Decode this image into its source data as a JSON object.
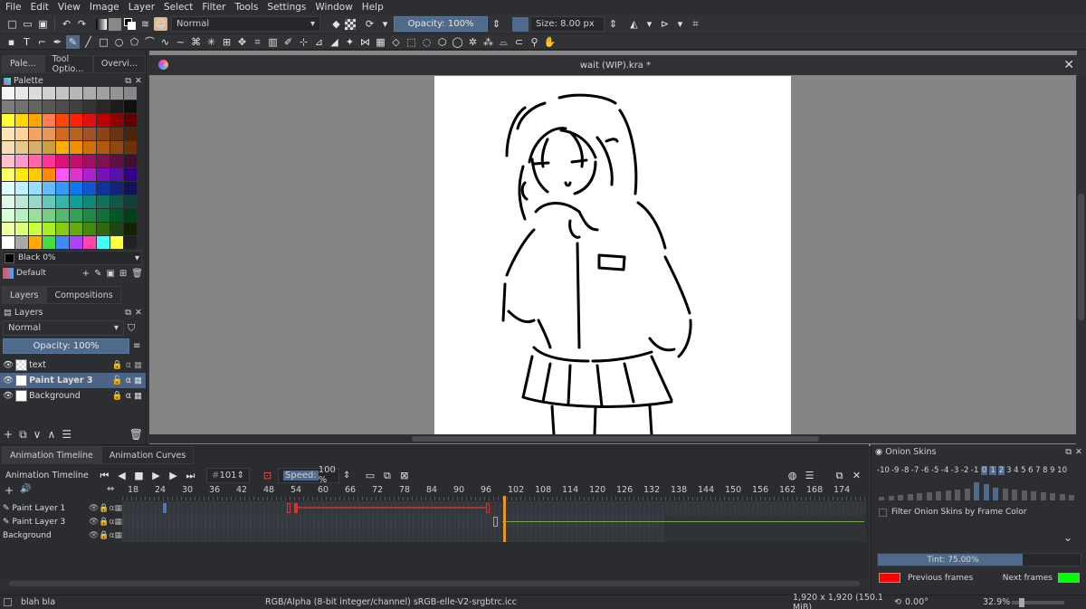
{
  "menubar": [
    "File",
    "Edit",
    "View",
    "Image",
    "Layer",
    "Select",
    "Filter",
    "Tools",
    "Settings",
    "Window",
    "Help"
  ],
  "toolbar": {
    "blend_mode": "Normal",
    "opacity": "Opacity: 100%",
    "size": "Size: 8.00 px"
  },
  "left_tabs": [
    "Pale...",
    "Tool Optio...",
    "Overvi..."
  ],
  "palette": {
    "title": "Palette",
    "current_color": "Black 0%",
    "palette_name": "Default",
    "rows": [
      [
        "#f5f5f5",
        "#e8e8e8",
        "#dcdcdc",
        "#d0d0d0",
        "#c4c4c4",
        "#b8b8b8",
        "#acacac",
        "#a0a0a0",
        "#949494",
        "#888888"
      ],
      [
        "#7c7c7c",
        "#707070",
        "#646464",
        "#585858",
        "#4c4c4c",
        "#404040",
        "#343434",
        "#282828",
        "#1c1c1c",
        "#101010"
      ],
      [
        "#ffff33",
        "#ffd700",
        "#ffa500",
        "#ff7f50",
        "#ff4500",
        "#ff2200",
        "#e01010",
        "#c00000",
        "#900000",
        "#600000"
      ],
      [
        "#ffe4b5",
        "#ffd39b",
        "#f4a460",
        "#e8965c",
        "#d2691e",
        "#b5651d",
        "#a0522d",
        "#8b4513",
        "#6b3410",
        "#4a2408"
      ],
      [
        "#f5deb3",
        "#e6c88a",
        "#d4b06a",
        "#c8a040",
        "#ffb000",
        "#f09000",
        "#d07000",
        "#b05a10",
        "#904810",
        "#703008"
      ],
      [
        "#ffc0cb",
        "#ff99cc",
        "#ff66aa",
        "#ff3399",
        "#e0107a",
        "#c0106a",
        "#a01060",
        "#801050",
        "#601040",
        "#401030"
      ],
      [
        "#ffff66",
        "#ffee00",
        "#ffcc00",
        "#ff8800",
        "#ff55ff",
        "#dd33cc",
        "#aa22cc",
        "#7711bb",
        "#5511aa",
        "#330088"
      ],
      [
        "#e0ffff",
        "#c0f0ff",
        "#99ddff",
        "#66bbff",
        "#3399ff",
        "#1177ee",
        "#1155cc",
        "#113399",
        "#112277",
        "#111155"
      ],
      [
        "#e0f8e8",
        "#c0e8d8",
        "#99d8c8",
        "#66c8b8",
        "#33b8a8",
        "#11a098",
        "#118878",
        "#117058",
        "#115848",
        "#114038"
      ],
      [
        "#d8ffd8",
        "#b8f0c0",
        "#99e0a0",
        "#77cc88",
        "#55b870",
        "#33a058",
        "#228848",
        "#117038",
        "#005828",
        "#004018"
      ],
      [
        "#eeffaa",
        "#ddff77",
        "#ccff44",
        "#aaee22",
        "#88cc11",
        "#66aa11",
        "#448811",
        "#336611",
        "#224411",
        "#112200"
      ],
      [
        "#ffffff",
        "#aaaaaa",
        "#ffaa00",
        "#44dd44",
        "#4488ff",
        "#aa44ff",
        "#ff44aa",
        "#44ffff",
        "#ffff44",
        "#222222"
      ]
    ]
  },
  "layers_tabs": [
    "Layers",
    "Compositions"
  ],
  "layers": {
    "title": "Layers",
    "blend_mode": "Normal",
    "opacity": "Opacity:  100%",
    "items": [
      {
        "name": "text",
        "selected": false
      },
      {
        "name": "Paint Layer 3",
        "selected": true
      },
      {
        "name": "Background",
        "selected": false
      }
    ]
  },
  "document": {
    "title": "wait (WIP).kra *"
  },
  "timeline": {
    "tabs": [
      "Animation Timeline",
      "Animation Curves"
    ],
    "title": "Animation Timeline",
    "frame": "101",
    "speed_label": "Speed:",
    "speed_value": "100 %",
    "ruler": [
      "18",
      "24",
      "30",
      "36",
      "42",
      "48",
      "54",
      "60",
      "66",
      "72",
      "78",
      "84",
      "90",
      "96",
      "102",
      "108",
      "114",
      "120",
      "126",
      "132",
      "138",
      "144",
      "150",
      "156",
      "162",
      "168",
      "174"
    ],
    "tracks": [
      "Paint Layer 1",
      "Paint Layer 3",
      "Background"
    ]
  },
  "onion": {
    "title": "Onion Skins",
    "numbers": [
      "-10",
      "-9",
      "-8",
      "-7",
      "-6",
      "-5",
      "-4",
      "-3",
      "-2",
      "-1",
      "0",
      "1",
      "2",
      "3",
      "4",
      "5",
      "6",
      "7",
      "8",
      "9",
      "10"
    ],
    "filter_label": "Filter Onion Skins by Frame Color",
    "tint": "Tint: 75.00%",
    "previous_label": "Previous frames",
    "next_label": "Next frames",
    "previous_color": "#ff0000",
    "next_color": "#00ff00"
  },
  "status": {
    "left": "blah bla",
    "color_space": "RGB/Alpha (8-bit integer/channel)  sRGB-elle-V2-srgbtrc.icc",
    "dimensions": "1,920 x 1,920 (150.1 MiB)",
    "rotation": "0.00°",
    "zoom": "32.9%"
  }
}
